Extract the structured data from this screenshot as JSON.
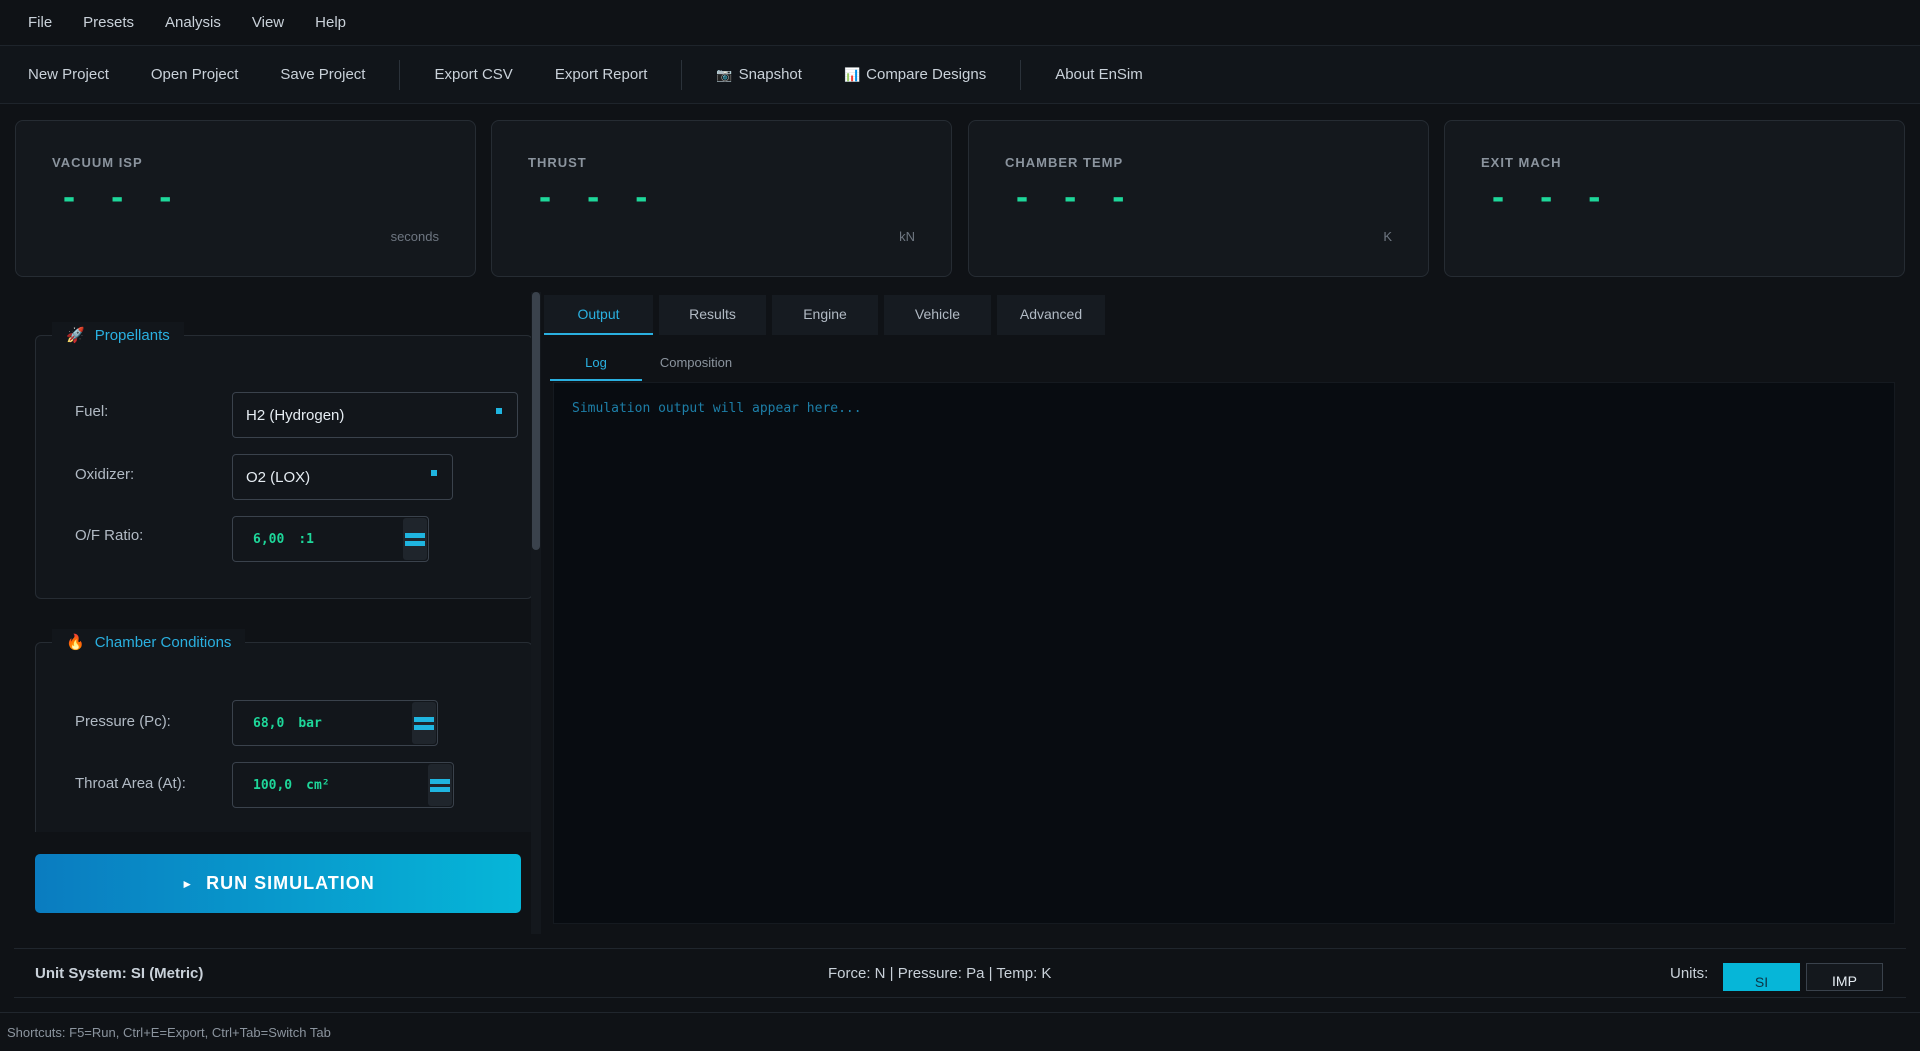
{
  "menu": [
    "File",
    "Presets",
    "Analysis",
    "View",
    "Help"
  ],
  "toolbar": {
    "new_project": "New Project",
    "open_project": "Open Project",
    "save_project": "Save Project",
    "export_csv": "Export CSV",
    "export_report": "Export Report",
    "snapshot_icon": "📷",
    "snapshot": "Snapshot",
    "compare_icon": "📊",
    "compare": "Compare Designs",
    "about": "About EnSim"
  },
  "stats": [
    {
      "label": "VACUUM ISP",
      "value": "- - -",
      "unit": "seconds"
    },
    {
      "label": "THRUST",
      "value": "- - -",
      "unit": "kN"
    },
    {
      "label": "CHAMBER TEMP",
      "value": "- - -",
      "unit": "K"
    },
    {
      "label": "EXIT MACH",
      "value": "- - -",
      "unit": ""
    }
  ],
  "propellants": {
    "icon": "🚀",
    "title": "Propellants",
    "fuel_label": "Fuel:",
    "fuel_value": "H2 (Hydrogen)",
    "oxidizer_label": "Oxidizer:",
    "oxidizer_value": "O2 (LOX)",
    "of_label": "O/F Ratio:",
    "of_value": "6,00",
    "of_unit": ":1"
  },
  "chamber": {
    "icon": "🔥",
    "title": "Chamber Conditions",
    "pressure_label": "Pressure (Pc):",
    "pressure_value": "68,0",
    "pressure_unit": "bar",
    "throat_label": "Throat Area (At):",
    "throat_value": "100,0",
    "throat_unit": "cm²"
  },
  "run_button": {
    "icon": "►",
    "label": "RUN SIMULATION"
  },
  "tabs": [
    "Output",
    "Results",
    "Engine",
    "Vehicle",
    "Advanced"
  ],
  "subtabs": [
    "Log",
    "Composition"
  ],
  "output_placeholder": "Simulation output will appear here...",
  "status": {
    "unit_system": "Unit System: SI (Metric)",
    "unit_info": "Force: N | Pressure: Pa | Temp: K",
    "units_label": "Units:",
    "si": "SI",
    "imp": "IMP"
  },
  "shortcuts": "Shortcuts: F5=Run, Ctrl+E=Export, Ctrl+Tab=Switch Tab",
  "colors": {
    "accent": "#2ab0e0",
    "value": "#1ed79a",
    "run_start": "#0a7cc0",
    "run_end": "#06b6d8"
  }
}
